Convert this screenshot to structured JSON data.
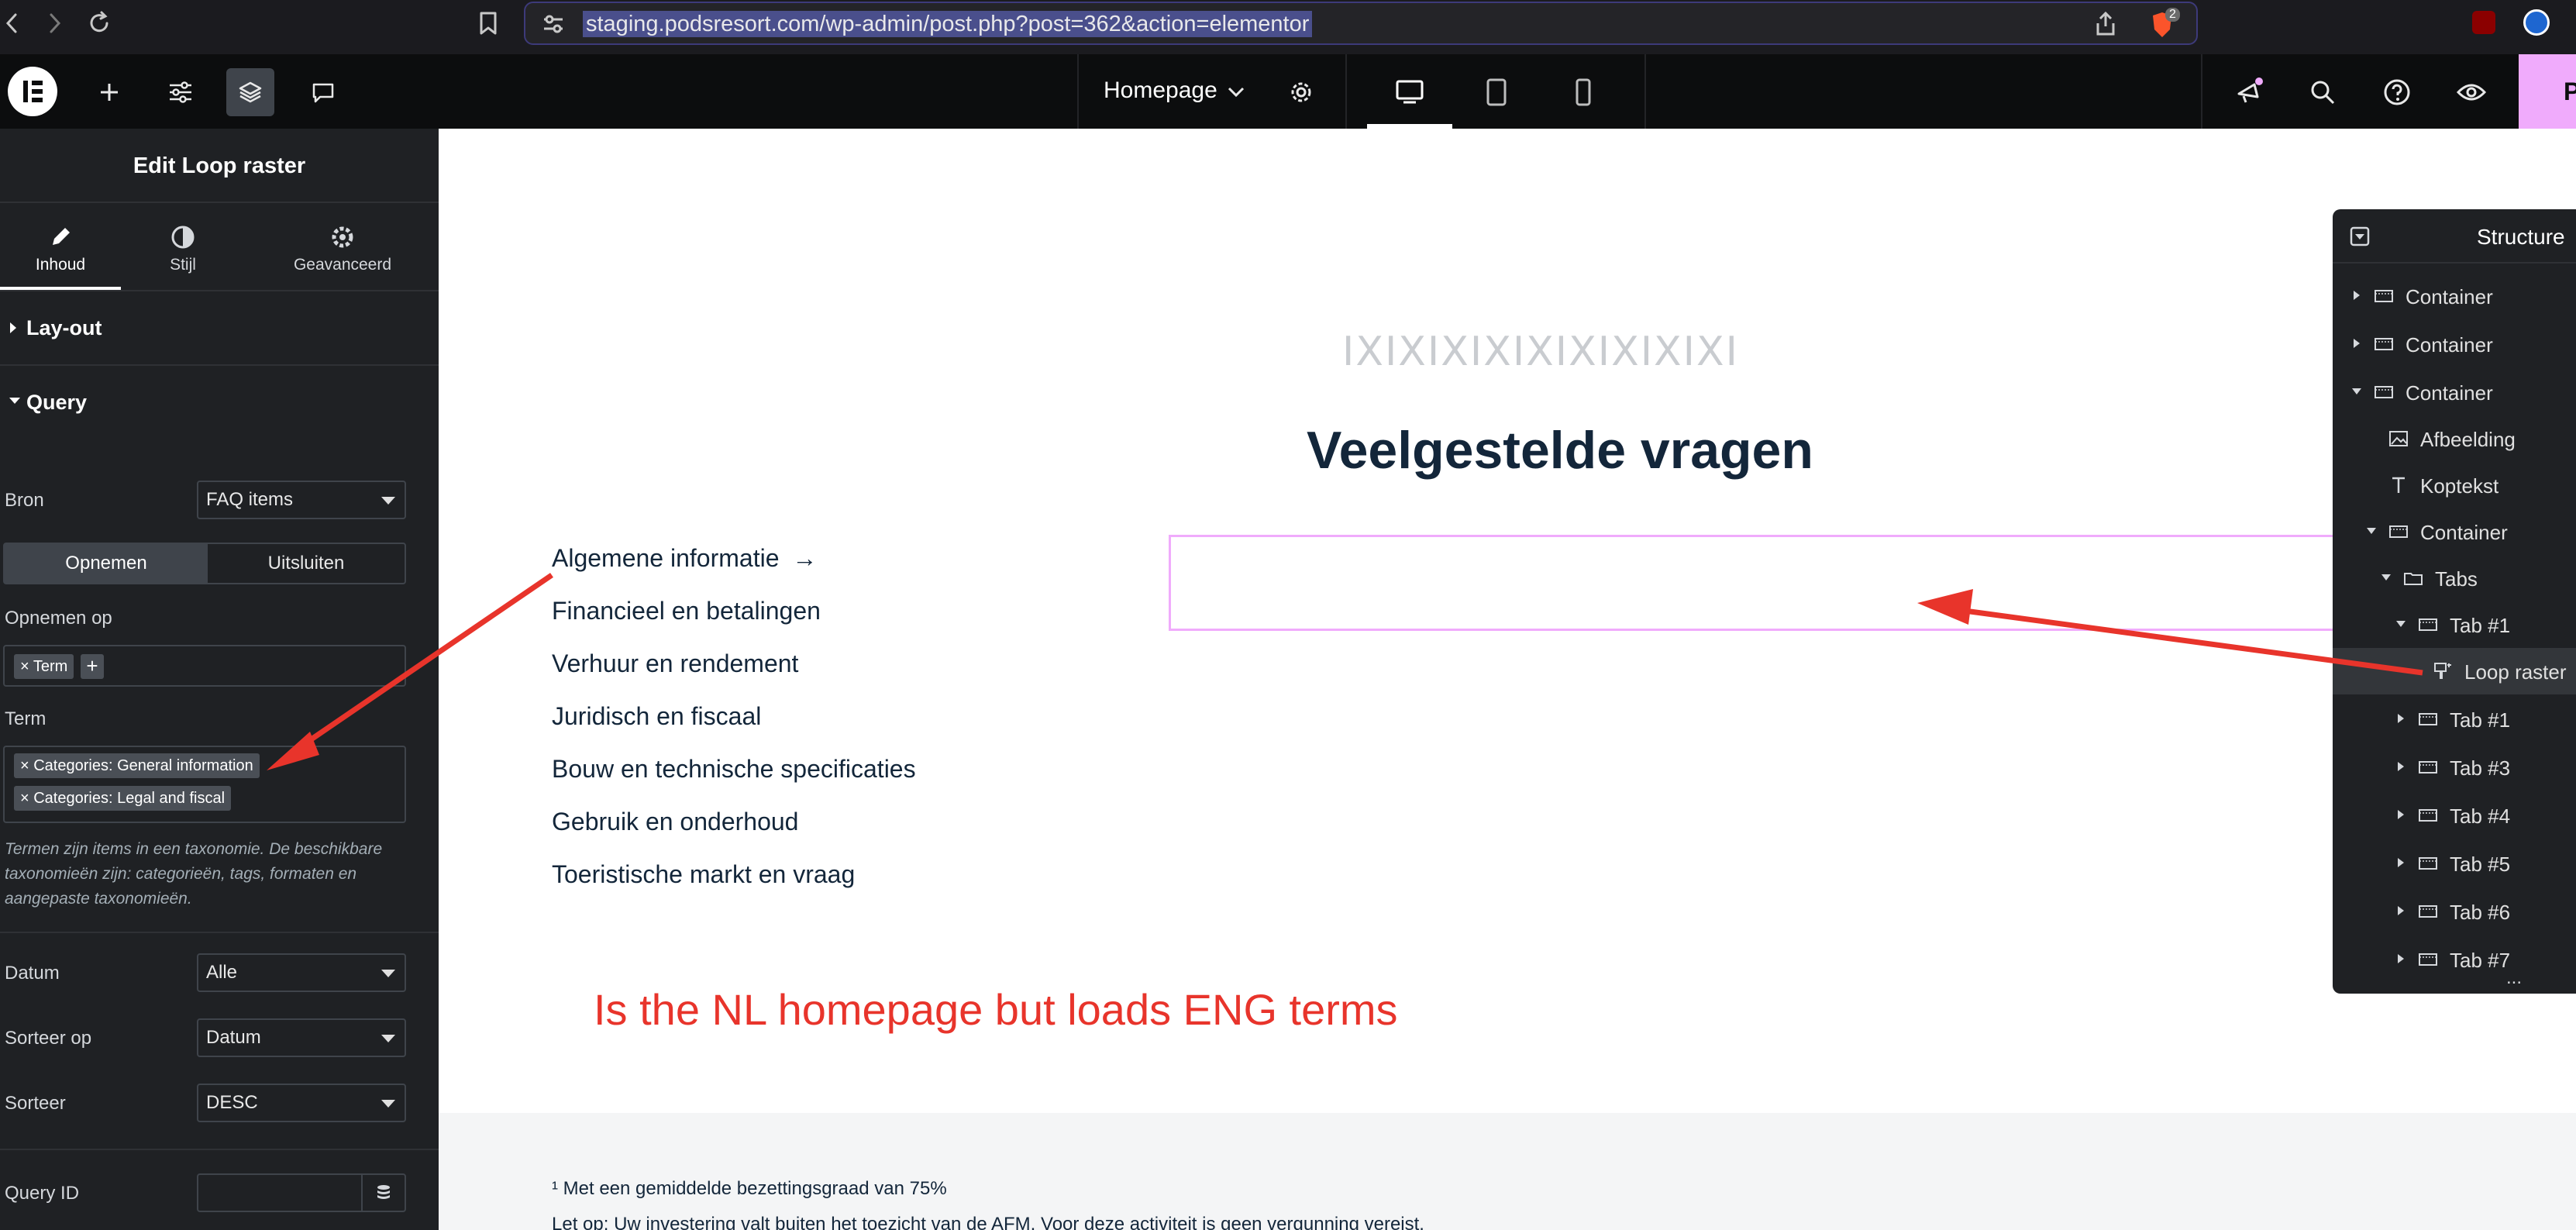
{
  "browser": {
    "url": "staging.podsresort.com/wp-admin/post.php?post=362&action=elementor",
    "extension_badge": "2"
  },
  "topbar": {
    "document_title": "Homepage",
    "publish_label": "P"
  },
  "panel": {
    "title": "Edit Loop raster",
    "tabs": [
      {
        "label": "Inhoud"
      },
      {
        "label": "Stijl"
      },
      {
        "label": "Geavanceerd"
      }
    ],
    "sections": {
      "layout": "Lay-out",
      "query": "Query"
    },
    "bron": {
      "label": "Bron",
      "value": "FAQ items"
    },
    "switch": {
      "include": "Opnemen",
      "exclude": "Uitsluiten"
    },
    "opnemen_op": {
      "label": "Opnemen op",
      "chip": "× Term",
      "add": "+"
    },
    "term": {
      "label": "Term",
      "chips": [
        "× Categories: General information",
        "× Categories: Legal and fiscal"
      ],
      "help": "Termen zijn items in een taxonomie. De beschikbare taxonomieën zijn: categorieën, tags, formaten en aangepaste taxonomieën."
    },
    "datum": {
      "label": "Datum",
      "value": "Alle"
    },
    "sorteer_op": {
      "label": "Sorteer op",
      "value": "Datum"
    },
    "sorteer": {
      "label": "Sorteer",
      "value": "DESC"
    },
    "query_id": {
      "label": "Query ID"
    }
  },
  "canvas": {
    "pattern": "IXIXIXIXIXIXIXIXIXI",
    "heading": "Veelgestelde vragen",
    "categories": [
      "Algemene informatie",
      "Financieel en betalingen",
      "Verhuur en rendement",
      "Juridisch en fiscaal",
      "Bouw en technische specificaties",
      "Gebruik en onderhoud",
      "Toeristische markt en vraag"
    ],
    "active_arrow": "→",
    "annotation": "Is the NL homepage but loads ENG terms",
    "footnote_1": "¹ Met een gemiddelde bezettingsgraad van 75%",
    "footnote_2": "Let op: Uw investering valt buiten het toezicht van de AFM. Voor deze activiteit is geen vergunning vereist."
  },
  "structure": {
    "title": "Structure",
    "rows": [
      {
        "label": "Container"
      },
      {
        "label": "Container"
      },
      {
        "label": "Container"
      },
      {
        "label": "Afbeelding"
      },
      {
        "label": "Koptekst"
      },
      {
        "label": "Container"
      },
      {
        "label": "Tabs"
      },
      {
        "label": "Tab #1"
      },
      {
        "label": "Loop raster"
      },
      {
        "label": "Tab #1"
      },
      {
        "label": "Tab #3"
      },
      {
        "label": "Tab #4"
      },
      {
        "label": "Tab #5"
      },
      {
        "label": "Tab #6"
      },
      {
        "label": "Tab #7"
      }
    ],
    "more": "..."
  },
  "colors": {
    "annotation_red": "#e8342b",
    "selection_pink": "#f0abfc",
    "panel_bg": "#1f2124",
    "heading_navy": "#13263a"
  }
}
